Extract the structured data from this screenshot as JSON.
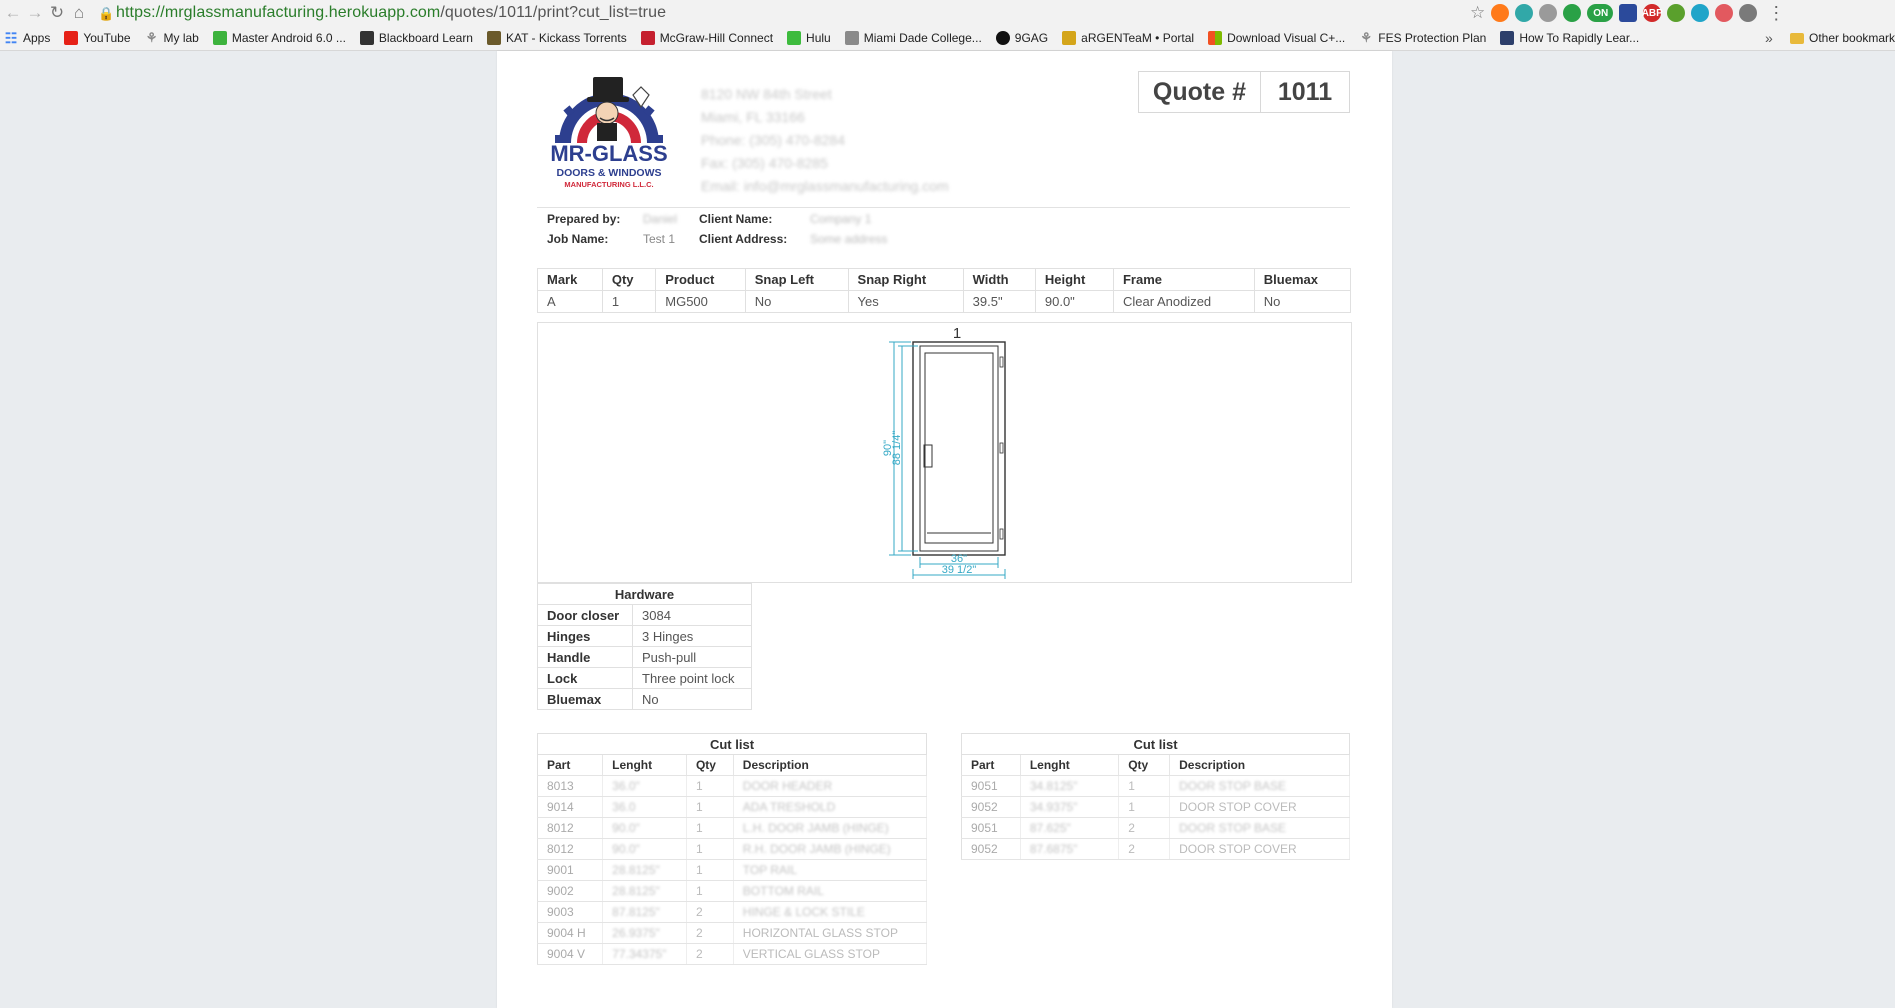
{
  "browser": {
    "url_host": "https://mrglassmanufacturing.herokuapp.com",
    "url_path": "/quotes/1011/print?cut_list=true",
    "toggle_label": "ON",
    "abp_label": "ABP",
    "bookmarks": [
      {
        "label": "Apps",
        "icon": "apps-grid-icon"
      },
      {
        "label": "YouTube",
        "icon": "youtube-icon"
      },
      {
        "label": "My lab",
        "icon": "lab-icon"
      },
      {
        "label": "Master Android 6.0 ...",
        "icon": "udemy-icon"
      },
      {
        "label": "Blackboard Learn",
        "icon": "blackboard-icon"
      },
      {
        "label": "KAT - Kickass Torrents",
        "icon": "kat-icon"
      },
      {
        "label": "McGraw-Hill Connect",
        "icon": "mcgraw-icon"
      },
      {
        "label": "Hulu",
        "icon": "hulu-icon"
      },
      {
        "label": "Miami Dade College...",
        "icon": "mdc-icon"
      },
      {
        "label": "9GAG",
        "icon": "9gag-icon"
      },
      {
        "label": "aRGENTeaM • Portal",
        "icon": "argenteam-icon"
      },
      {
        "label": "Download Visual C+...",
        "icon": "microsoft-icon"
      },
      {
        "label": "FES Protection Plan",
        "icon": "fes-icon"
      },
      {
        "label": "How To Rapidly Lear...",
        "icon": "howto-icon"
      }
    ],
    "more_label": "»",
    "other_bookmarks": "Other bookmarks"
  },
  "company": {
    "logo_title": "MR-GLASS",
    "logo_line2": "DOORS & WINDOWS",
    "logo_line3": "MANUFACTURING L.L.C.",
    "address1": "8120 NW 84th Street",
    "address2": "Miami, FL 33166",
    "phone": "Phone: (305) 470-8284",
    "fax": "Fax: (305) 470-8285",
    "email": "Email: info@mrglassmanufacturing.com"
  },
  "quote": {
    "label": "Quote #",
    "number": "1011"
  },
  "meta": {
    "prepared_by_label": "Prepared by:",
    "prepared_by": "Daniel",
    "client_name_label": "Client Name:",
    "client_name": "Company 1",
    "job_name_label": "Job Name:",
    "job_name": "Test 1",
    "client_address_label": "Client Address:",
    "client_address": "Some address"
  },
  "spec": {
    "headers": [
      "Mark",
      "Qty",
      "Product",
      "Snap Left",
      "Snap Right",
      "Width",
      "Height",
      "Frame",
      "Bluemax"
    ],
    "row": [
      "A",
      "1",
      "MG500",
      "No",
      "Yes",
      "39.5\"",
      "90.0\"",
      "Clear Anodized",
      "No"
    ]
  },
  "drawing": {
    "label": "1",
    "height_outer": "90\"",
    "height_inner": "88 1/4\"",
    "width_inner": "36\"",
    "width_outer": "39 1/2\"",
    "line_color": "#35a9c6"
  },
  "hardware": {
    "title": "Hardware",
    "items": [
      {
        "k": "Door closer",
        "v": "3084"
      },
      {
        "k": "Hinges",
        "v": "3 Hinges"
      },
      {
        "k": "Handle",
        "v": "Push-pull"
      },
      {
        "k": "Lock",
        "v": "Three point lock"
      },
      {
        "k": "Bluemax",
        "v": "No"
      }
    ]
  },
  "cut_left": {
    "title": "Cut list",
    "headers": [
      "Part",
      "Lenght",
      "Qty",
      "Description"
    ],
    "rows": [
      {
        "part": "8013",
        "len": "36.0\"",
        "qty": "1",
        "desc": "DOOR HEADER"
      },
      {
        "part": "9014",
        "len": "36.0",
        "qty": "1",
        "desc": "ADA TRESHOLD"
      },
      {
        "part": "8012",
        "len": "90.0\"",
        "qty": "1",
        "desc": "L.H. DOOR JAMB (HINGE)"
      },
      {
        "part": "8012",
        "len": "90.0\"",
        "qty": "1",
        "desc": "R.H. DOOR JAMB (HINGE)"
      },
      {
        "part": "9001",
        "len": "28.8125\"",
        "qty": "1",
        "desc": "TOP RAIL"
      },
      {
        "part": "9002",
        "len": "28.8125\"",
        "qty": "1",
        "desc": "BOTTOM RAIL"
      },
      {
        "part": "9003",
        "len": "87.8125\"",
        "qty": "2",
        "desc": "HINGE & LOCK STILE"
      },
      {
        "part": "9004 H",
        "len": "26.9375\"",
        "qty": "2",
        "desc": "HORIZONTAL GLASS STOP"
      },
      {
        "part": "9004 V",
        "len": "77.34375\"",
        "qty": "2",
        "desc": "VERTICAL GLASS STOP"
      }
    ]
  },
  "cut_right": {
    "title": "Cut list",
    "headers": [
      "Part",
      "Lenght",
      "Qty",
      "Description"
    ],
    "rows": [
      {
        "part": "9051",
        "len": "34.8125\"",
        "qty": "1",
        "desc": "DOOR STOP BASE"
      },
      {
        "part": "9052",
        "len": "34.9375\"",
        "qty": "1",
        "desc": "DOOR STOP COVER"
      },
      {
        "part": "9051",
        "len": "87.625\"",
        "qty": "2",
        "desc": "DOOR STOP BASE"
      },
      {
        "part": "9052",
        "len": "87.6875\"",
        "qty": "2",
        "desc": "DOOR STOP COVER"
      }
    ]
  }
}
